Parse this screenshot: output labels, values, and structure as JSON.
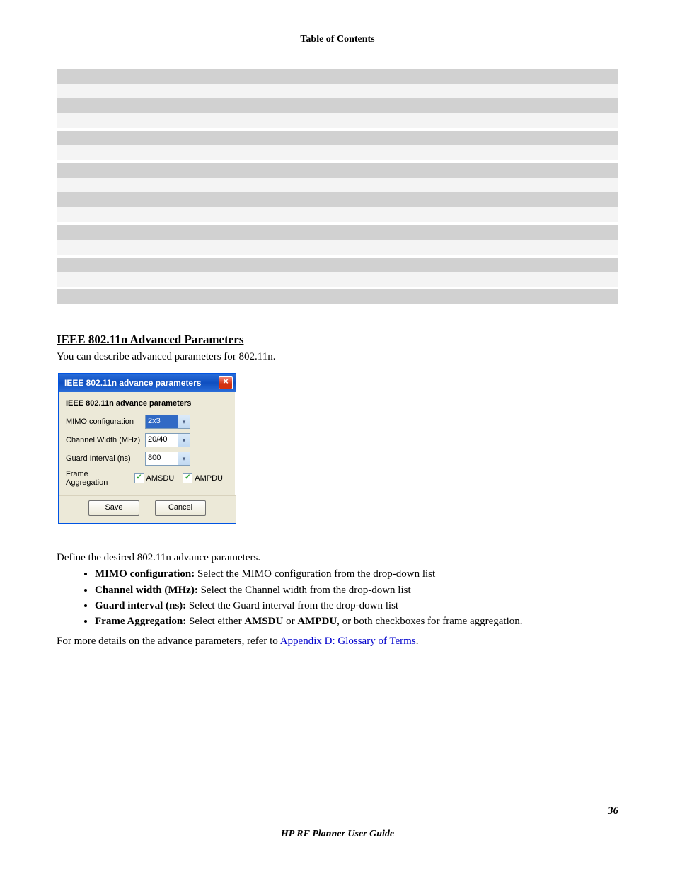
{
  "header": {
    "toc": "Table of Contents"
  },
  "rows": [
    {
      "shade": "dark",
      "l": "",
      "r": ""
    },
    {
      "shade": "light",
      "l": "",
      "r": ""
    },
    {
      "shade": "dark",
      "l": "",
      "r": ""
    },
    {
      "shade": "light",
      "l": "",
      "r": ""
    },
    {
      "shade": "dark",
      "l": "",
      "r": ""
    },
    {
      "shade": "light",
      "l": "",
      "r": ""
    },
    {
      "shade": "dark",
      "l": "",
      "r": ""
    },
    {
      "shade": "light",
      "l": "",
      "r": ""
    },
    {
      "shade": "dark",
      "l": "",
      "r": ""
    },
    {
      "shade": "light",
      "l": "",
      "r": ""
    },
    {
      "shade": "dark",
      "l": "",
      "r": ""
    },
    {
      "shade": "light",
      "l": "",
      "r": ""
    },
    {
      "shade": "dark",
      "l": "",
      "r": ""
    },
    {
      "shade": "light",
      "l": "",
      "r": ""
    },
    {
      "shade": "dark",
      "l": "",
      "r": ""
    }
  ],
  "section": {
    "heading": "IEEE 802.11n Advanced Parameters",
    "intro": "You can describe advanced parameters for 802.11n."
  },
  "dialog": {
    "title": "IEEE 802.11n advance parameters",
    "subhead": "IEEE 802.11n advance parameters",
    "mimo_label": "MIMO configuration",
    "mimo_value": "2x3",
    "cw_label": "Channel Width (MHz)",
    "cw_value": "20/40",
    "gi_label": "Guard Interval (ns)",
    "gi_value": "800",
    "fa_label": "Frame Aggregation",
    "amsdu": "AMSDU",
    "ampdu": "AMPDU",
    "save": "Save",
    "cancel": "Cancel",
    "close_glyph": "×"
  },
  "after": {
    "define": "Define the desired 802.11n advance parameters.",
    "b1_bold": "MIMO configuration:",
    "b1_rest": " Select the MIMO configuration from the drop-down list",
    "b2_bold": "Channel width (MHz):",
    "b2_rest": " Select the Channel width from the drop-down list",
    "b3_bold": "Guard interval (ns):",
    "b3_rest": " Select the Guard interval from the drop-down list",
    "b4_bold": "Frame Aggregation:",
    "b4_mid1": " Select either ",
    "b4_amsdu": "AMSDU",
    "b4_or": " or ",
    "b4_ampdu": "AMPDU",
    "b4_rest": ", or both checkboxes for frame aggregation.",
    "more_pre": "For more details on the advance parameters, refer to ",
    "more_link": "Appendix D: Glossary of Terms",
    "more_post": "."
  },
  "footer": {
    "center": "HP RF Planner User Guide",
    "page": "36"
  },
  "glyphs": {
    "down": "▾",
    "check": "✓"
  }
}
